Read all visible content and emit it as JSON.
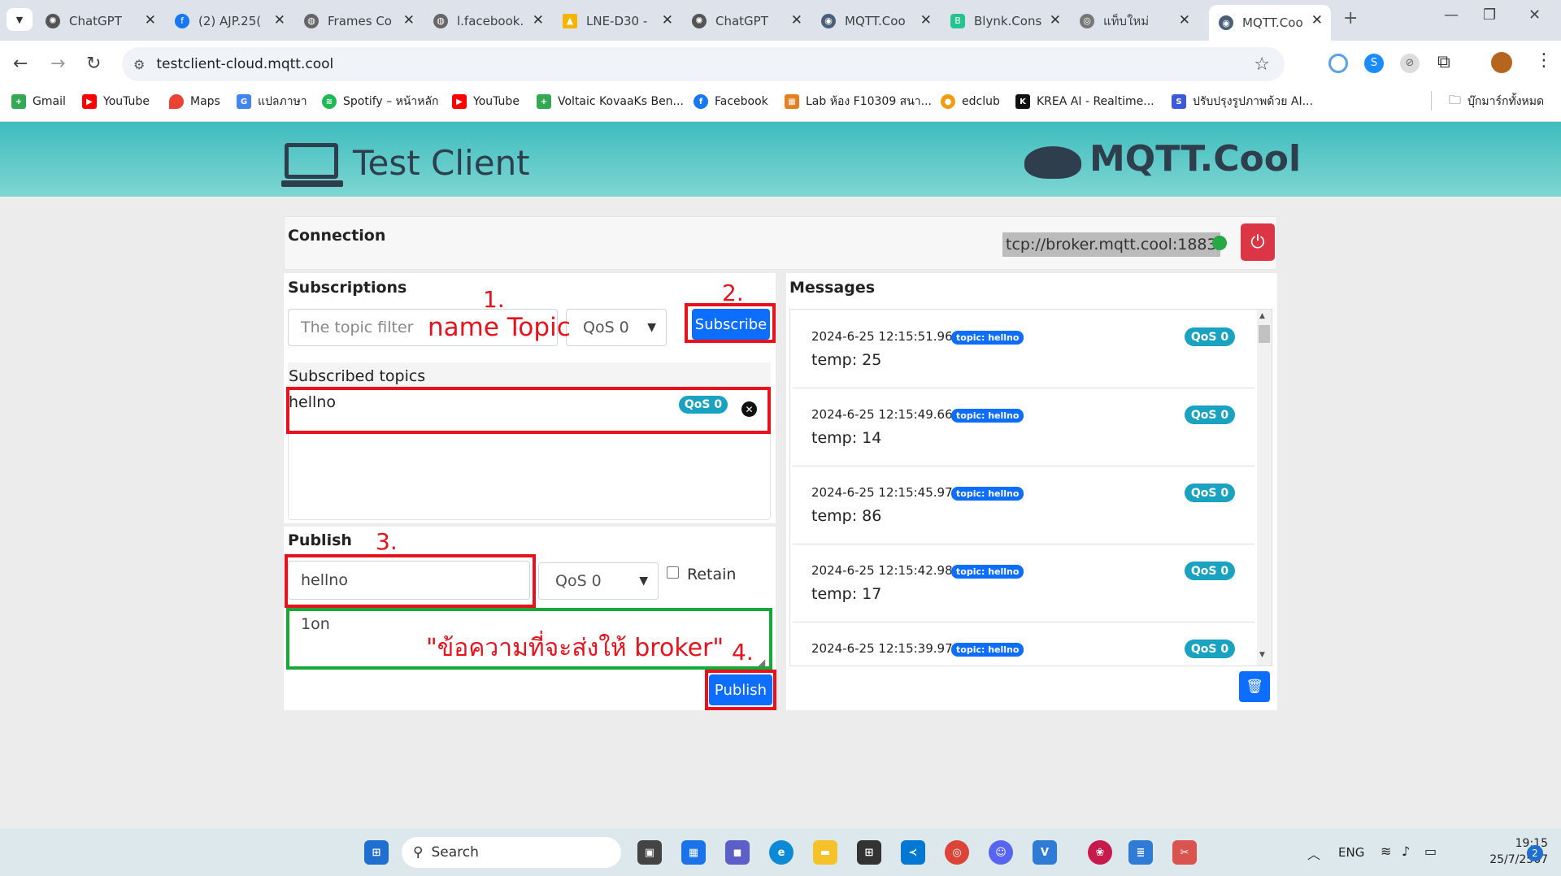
{
  "browser": {
    "tabs": [
      {
        "title": "ChatGPT",
        "icon": "chatgpt-icon"
      },
      {
        "title": "(2) AJP.25(",
        "icon": "facebook-icon"
      },
      {
        "title": "Frames Co",
        "icon": "globe-icon"
      },
      {
        "title": "l.facebook.",
        "icon": "globe-icon"
      },
      {
        "title": "LNE-D30 -",
        "icon": "google-drive-icon"
      },
      {
        "title": "ChatGPT",
        "icon": "chatgpt-icon"
      },
      {
        "title": "MQTT.Coo",
        "icon": "mqtt-icon"
      },
      {
        "title": "Blynk.Cons",
        "icon": "blynk-icon"
      },
      {
        "title": "แท็บใหม่",
        "icon": "chrome-icon"
      },
      {
        "title": "MQTT.Coo",
        "icon": "mqtt-icon",
        "active": true
      }
    ],
    "url": "testclient-cloud.mqtt.cool",
    "bookmarks": [
      "Gmail",
      "YouTube",
      "Maps",
      "แปลภาษา",
      "Spotify – หน้าหลัก",
      "YouTube",
      "Voltaic KovaaKs Ben...",
      "Facebook",
      "Lab ห้อง F10309 สนา...",
      "edclub",
      "KREA AI - Realtime...",
      "ปรับปรุงรูปภาพด้วย AI..."
    ],
    "bookmarks_folder": "บุ๊กมาร์กทั้งหมด"
  },
  "app": {
    "title": "Test Client",
    "brand": "MQTT.Cool",
    "connection": {
      "label": "Connection",
      "broker": "tcp://broker.mqtt.cool:1883",
      "status_color": "#28a745"
    },
    "subscriptions": {
      "label": "Subscriptions",
      "topic_placeholder": "The topic filter",
      "qos": "QoS 0",
      "subscribe_label": "Subscribe",
      "subscribed_label": "Subscribed topics",
      "items": [
        {
          "topic": "hellno",
          "qos": "QoS 0"
        }
      ]
    },
    "publish": {
      "label": "Publish",
      "topic": "hellno",
      "qos": "QoS 0",
      "retain_label": "Retain",
      "message": "1on",
      "publish_label": "Publish"
    },
    "messages": {
      "label": "Messages",
      "items": [
        {
          "time": "2024-6-25 12:15:51.964",
          "topic": "topic: hellno",
          "qos": "QoS 0",
          "payload": "temp: 25"
        },
        {
          "time": "2024-6-25 12:15:49.663",
          "topic": "topic: hellno",
          "qos": "QoS 0",
          "payload": "temp: 14"
        },
        {
          "time": "2024-6-25 12:15:45.970",
          "topic": "topic: hellno",
          "qos": "QoS 0",
          "payload": "temp: 86"
        },
        {
          "time": "2024-6-25 12:15:42.986",
          "topic": "topic: hellno",
          "qos": "QoS 0",
          "payload": "temp: 17"
        },
        {
          "time": "2024-6-25 12:15:39.975",
          "topic": "topic: hellno",
          "qos": "QoS 0",
          "payload": ""
        }
      ]
    }
  },
  "annotations": {
    "n1": "1.",
    "name_topic": "name Topic",
    "n2": "2.",
    "n3": "3.",
    "n4": "4.",
    "message_note": "\"ข้อความที่จะส่งให้ broker\""
  },
  "taskbar": {
    "search": "Search",
    "lang": "ENG",
    "time": "19:15",
    "date": "25/7/2567",
    "notif": "2"
  }
}
